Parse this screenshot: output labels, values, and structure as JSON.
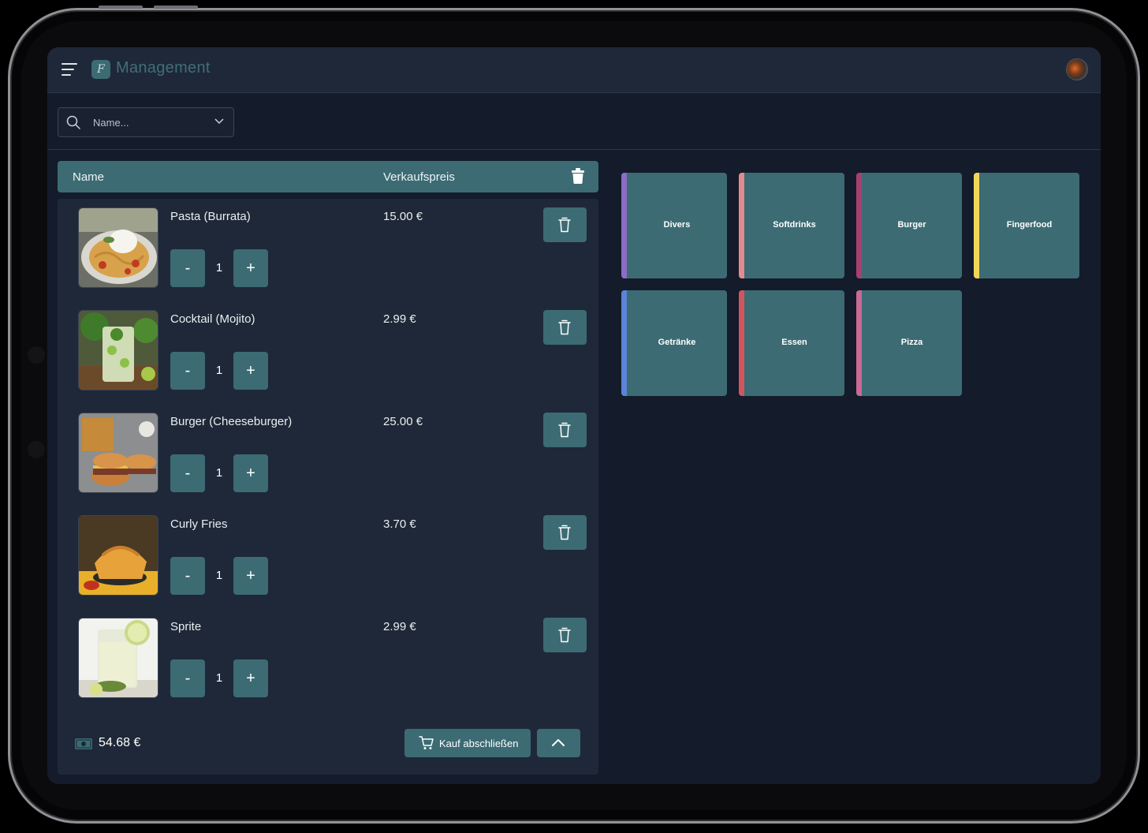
{
  "app": {
    "title": "Management",
    "logo_letter": "F"
  },
  "search": {
    "placeholder": "Name..."
  },
  "cart": {
    "header": {
      "name_label": "Name",
      "price_label": "Verkaufspreis"
    },
    "items": [
      {
        "name": "Pasta (Burrata)",
        "price": "15.00 €",
        "qty": "1",
        "image": "pasta-image"
      },
      {
        "name": "Cocktail (Mojito)",
        "price": "2.99 €",
        "qty": "1",
        "image": "mojito-image"
      },
      {
        "name": "Burger (Cheeseburger)",
        "price": "25.00 €",
        "qty": "1",
        "image": "burger-image"
      },
      {
        "name": "Curly Fries",
        "price": "3.70 €",
        "qty": "1",
        "image": "fries-image"
      },
      {
        "name": "Sprite",
        "price": "2.99 €",
        "qty": "1",
        "image": "sprite-image"
      }
    ],
    "minus_label": "-",
    "plus_label": "+",
    "total": "54.68 €",
    "checkout_label": "Kauf abschließen"
  },
  "categories": [
    {
      "label": "Divers",
      "color": "#8b6cc7"
    },
    {
      "label": "Softdrinks",
      "color": "#e38b8e"
    },
    {
      "label": "Burger",
      "color": "#a8406f"
    },
    {
      "label": "Fingerfood",
      "color": "#f0d65a"
    },
    {
      "label": "Getränke",
      "color": "#5b84d9"
    },
    {
      "label": "Essen",
      "color": "#d2555e"
    },
    {
      "label": "Pizza",
      "color": "#c86a95"
    }
  ],
  "colors": {
    "accent": "#3c6b74",
    "background": "#141b2a",
    "panel": "#1f2838"
  }
}
